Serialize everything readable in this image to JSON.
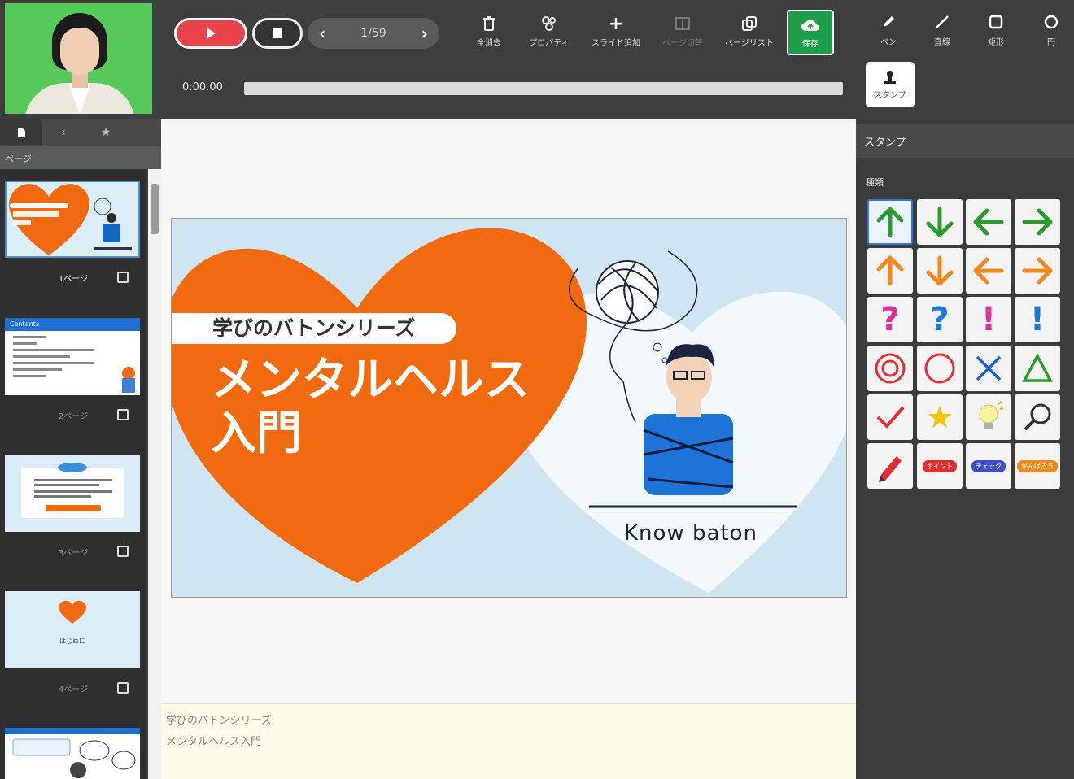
{
  "toolbar": {
    "pager": {
      "current": "1/59"
    },
    "tools": [
      {
        "name": "toolbar-delete-all",
        "label": "全消去",
        "icon": "trash-icon"
      },
      {
        "name": "toolbar-properties",
        "label": "プロパティ",
        "icon": "properties-icon"
      },
      {
        "name": "toolbar-add-slide",
        "label": "スライド追加",
        "icon": "plus-icon"
      },
      {
        "name": "toolbar-page-toggle",
        "label": "ページ切替",
        "icon": "page-toggle-icon",
        "disabled": true
      },
      {
        "name": "toolbar-page-list",
        "label": "ページリスト",
        "icon": "page-list-icon"
      }
    ],
    "save_label": "保存",
    "time": "0:00.00"
  },
  "draw_tools": [
    {
      "label": "ペン",
      "icon": "pen-icon"
    },
    {
      "label": "直線",
      "icon": "line-icon"
    },
    {
      "label": "矩形",
      "icon": "rectangle-icon"
    },
    {
      "label": "円",
      "icon": "circle-icon"
    }
  ],
  "stamp_tool_label": "スタンプ",
  "left_panel": {
    "page_header": "ページ",
    "thumbnails": [
      {
        "caption": "1ページ",
        "active": true
      },
      {
        "caption": "2ページ",
        "active": false,
        "title": "Contents"
      },
      {
        "caption": "3ページ",
        "active": false
      },
      {
        "caption": "4ページ",
        "active": false,
        "title": "はじめに"
      }
    ]
  },
  "slide": {
    "series": "学びのバトンシリーズ",
    "title_line1": "メンタルヘルス",
    "title_line2": "入門",
    "brand": "Know baton"
  },
  "notes": {
    "line1": "学びのバトンシリーズ",
    "line2": "メンタルヘルス入門"
  },
  "right_panel": {
    "header": "スタンプ",
    "kind_label": "種類",
    "pills": [
      "ポイント",
      "チェック",
      "がんばろう"
    ]
  },
  "colors": {
    "play": "#e8434b",
    "save": "#1f9d4a",
    "slide_orange": "#f26a10",
    "arrow_green": "#2c9b2c",
    "arrow_orange": "#f0891d",
    "mark_pink": "#e0309a",
    "mark_blue": "#1a78e0",
    "mark_red": "#e03030"
  }
}
